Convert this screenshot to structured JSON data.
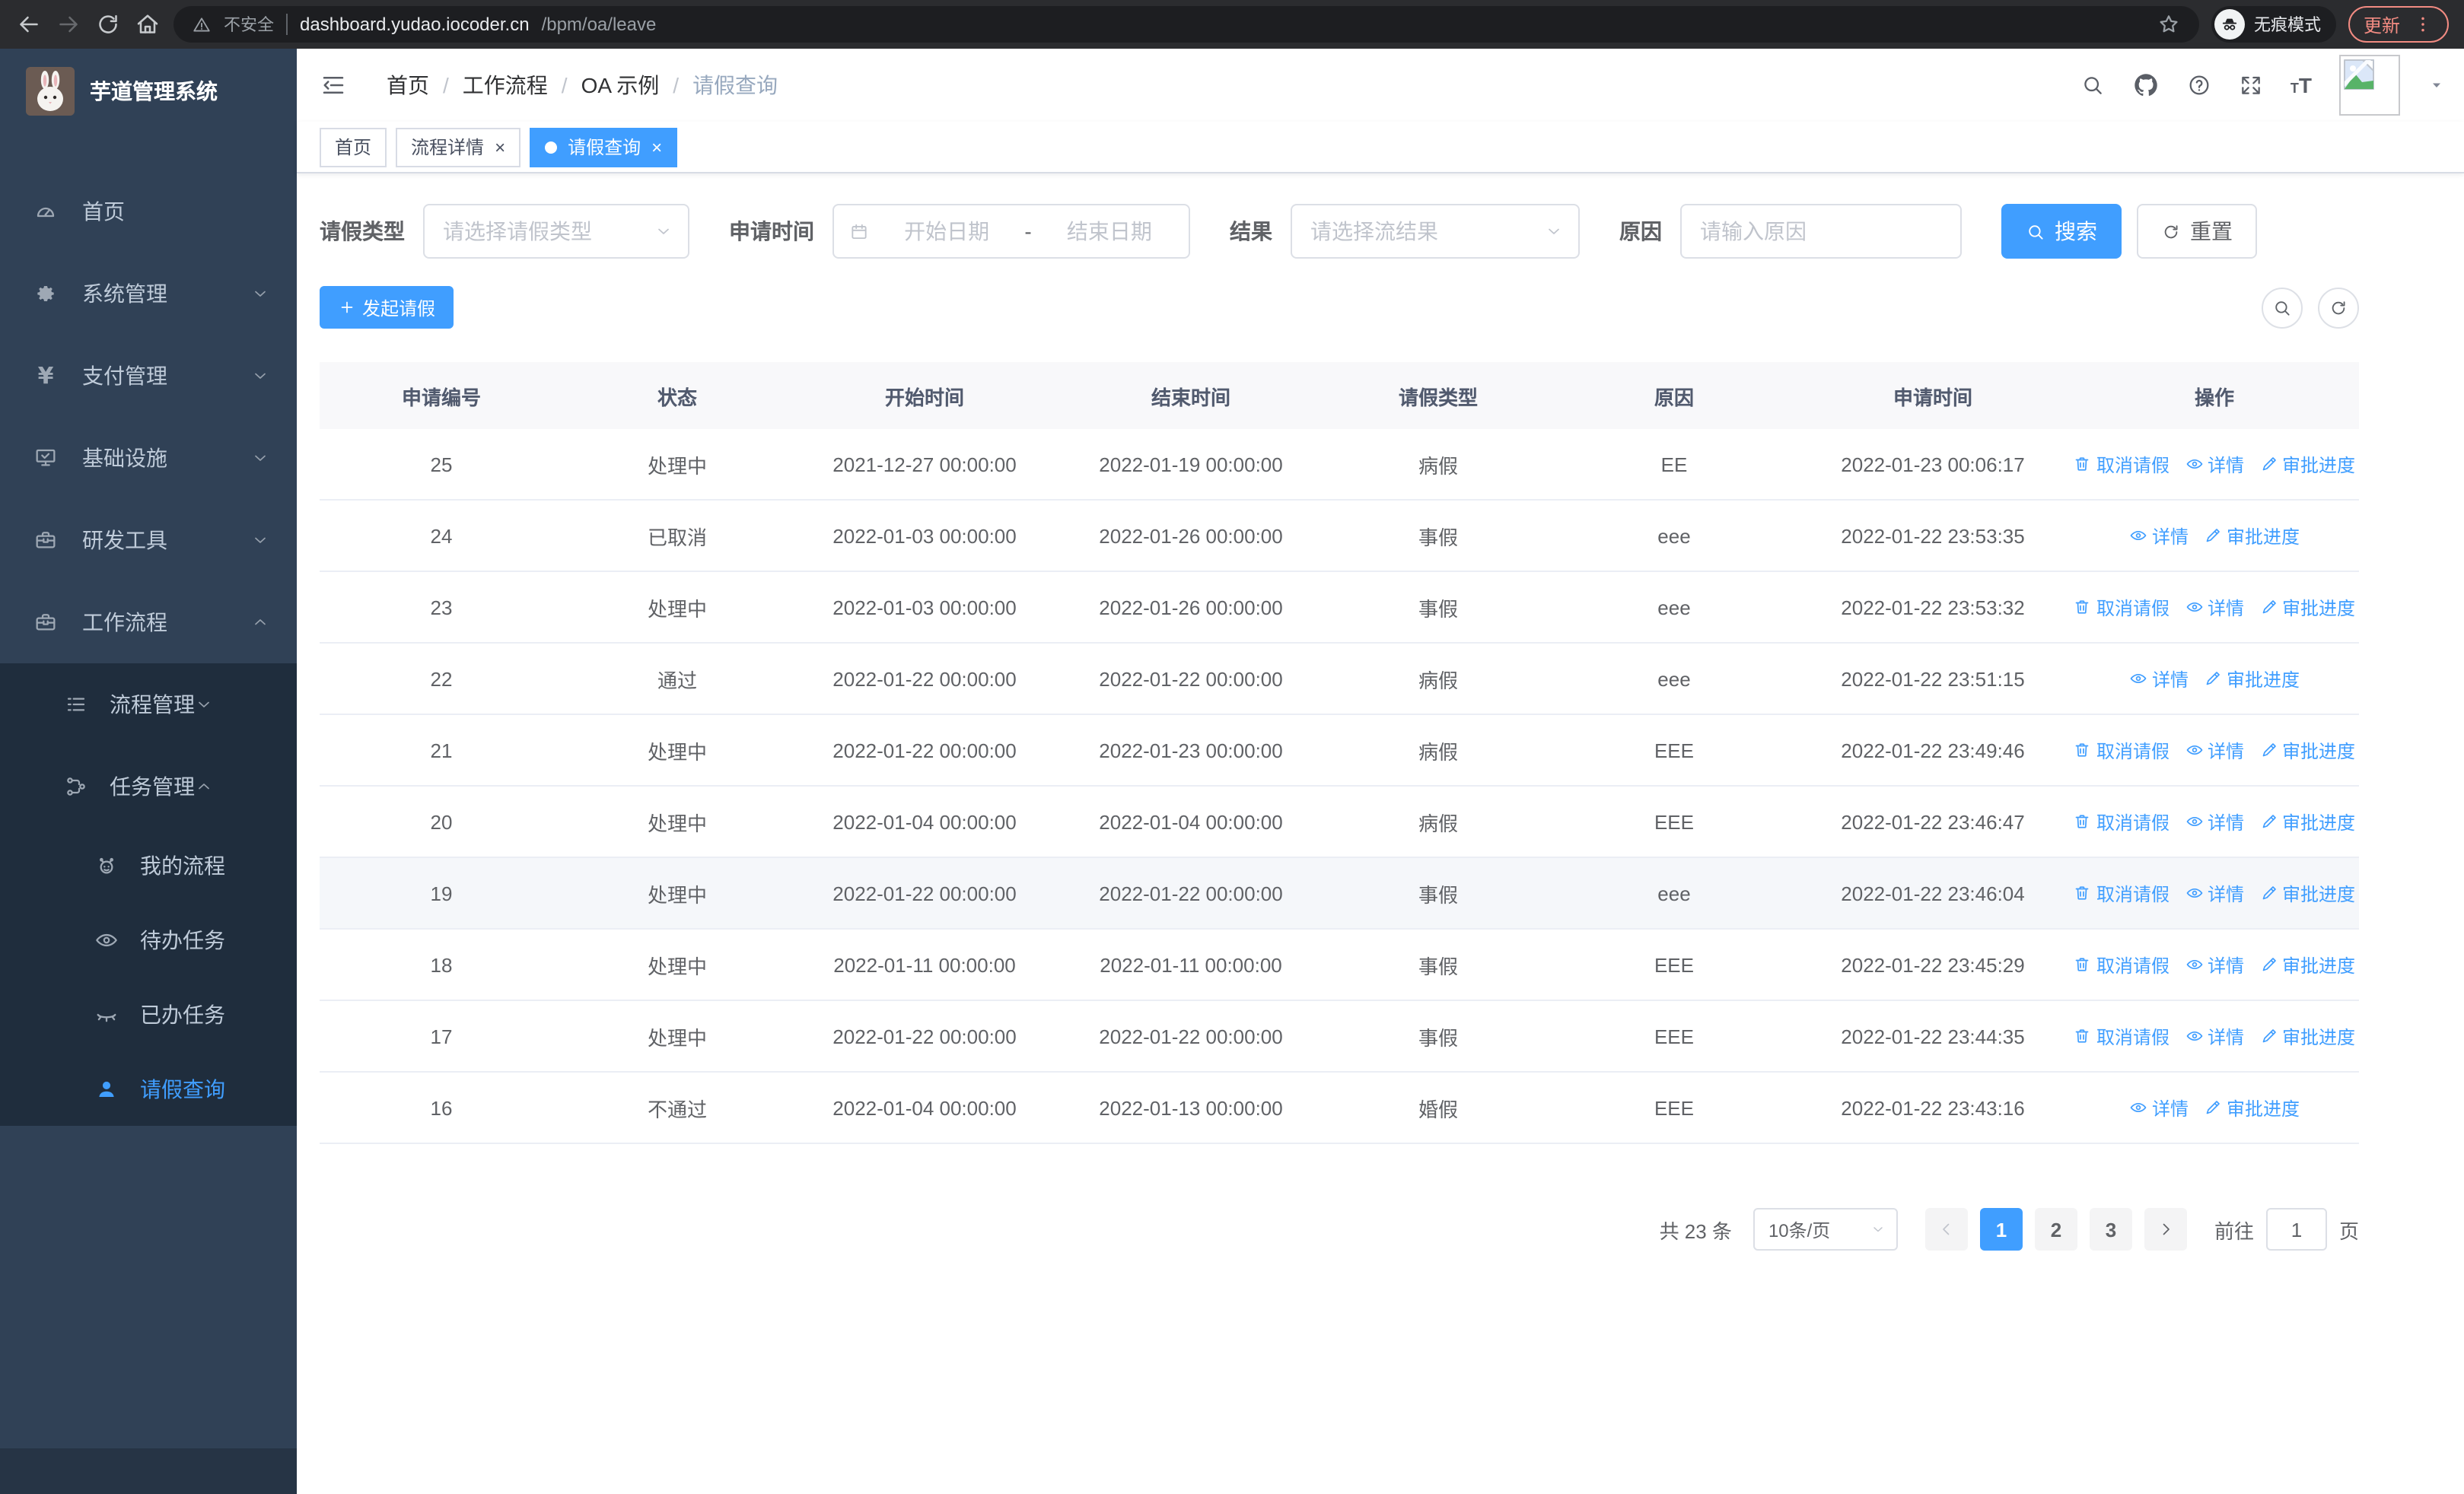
{
  "browser": {
    "security_label": "不安全",
    "url_host": "dashboard.yudao.iocoder.cn",
    "url_path": "/bpm/oa/leave",
    "incognito_label": "无痕模式",
    "update_label": "更新",
    "icons": [
      "back-icon",
      "forward-icon",
      "reload-icon",
      "home-icon",
      "warning-icon",
      "star-icon",
      "incognito-icon",
      "kebab-menu-icon"
    ]
  },
  "sidebar": {
    "logo_title": "芋道管理系统",
    "items": [
      {
        "label": "首页",
        "icon": "dashboard-icon"
      },
      {
        "label": "系统管理",
        "icon": "gear-icon",
        "state": "collapsed"
      },
      {
        "label": "支付管理",
        "icon": "yen-icon",
        "state": "collapsed"
      },
      {
        "label": "基础设施",
        "icon": "monitor-icon",
        "state": "collapsed"
      },
      {
        "label": "研发工具",
        "icon": "toolbox-icon",
        "state": "collapsed"
      },
      {
        "label": "工作流程",
        "icon": "briefcase-icon",
        "state": "expanded"
      }
    ],
    "submenu": [
      {
        "label": "流程管理",
        "icon": "list-icon",
        "state": "collapsed"
      },
      {
        "label": "任务管理",
        "icon": "flow-icon",
        "state": "expanded",
        "children": [
          {
            "label": "我的流程",
            "icon": "robot-icon"
          },
          {
            "label": "待办任务",
            "icon": "eye-icon"
          },
          {
            "label": "已办任务",
            "icon": "eye-closed-icon"
          },
          {
            "label": "请假查询",
            "icon": "user-icon",
            "active": true
          }
        ]
      }
    ]
  },
  "header": {
    "breadcrumb": [
      "首页",
      "工作流程",
      "OA 示例",
      "请假查询"
    ],
    "separator": "/",
    "right_icons": [
      "search-icon",
      "github-icon",
      "help-icon",
      "fullscreen-icon",
      "font-size-icon",
      "avatar-broken-image",
      "caret-down-icon"
    ]
  },
  "tags": [
    {
      "label": "首页",
      "active": false,
      "closable": false
    },
    {
      "label": "流程详情",
      "active": false,
      "closable": true
    },
    {
      "label": "请假查询",
      "active": true,
      "closable": true
    }
  ],
  "filters": {
    "leave_type_label": "请假类型",
    "leave_type_placeholder": "请选择请假类型",
    "apply_time_label": "申请时间",
    "start_date_placeholder": "开始日期",
    "range_separator": "-",
    "end_date_placeholder": "结束日期",
    "result_label": "结果",
    "result_placeholder": "请选择流结果",
    "reason_label": "原因",
    "reason_placeholder": "请输入原因",
    "search_button": "搜索",
    "reset_button": "重置"
  },
  "toolbar": {
    "create_button": "发起请假"
  },
  "table": {
    "columns": [
      "申请编号",
      "状态",
      "开始时间",
      "结束时间",
      "请假类型",
      "原因",
      "申请时间",
      "操作"
    ],
    "action_labels": {
      "cancel": "取消请假",
      "detail": "详情",
      "progress": "审批进度"
    },
    "rows": [
      {
        "id": "25",
        "status": "处理中",
        "start": "2021-12-27 00:00:00",
        "end": "2022-01-19 00:00:00",
        "type": "病假",
        "reason": "EE",
        "apply": "2022-01-23 00:06:17",
        "actions": [
          "cancel",
          "detail",
          "progress"
        ]
      },
      {
        "id": "24",
        "status": "已取消",
        "start": "2022-01-03 00:00:00",
        "end": "2022-01-26 00:00:00",
        "type": "事假",
        "reason": "eee",
        "apply": "2022-01-22 23:53:35",
        "actions": [
          "detail",
          "progress"
        ]
      },
      {
        "id": "23",
        "status": "处理中",
        "start": "2022-01-03 00:00:00",
        "end": "2022-01-26 00:00:00",
        "type": "事假",
        "reason": "eee",
        "apply": "2022-01-22 23:53:32",
        "actions": [
          "cancel",
          "detail",
          "progress"
        ]
      },
      {
        "id": "22",
        "status": "通过",
        "start": "2022-01-22 00:00:00",
        "end": "2022-01-22 00:00:00",
        "type": "病假",
        "reason": "eee",
        "apply": "2022-01-22 23:51:15",
        "actions": [
          "detail",
          "progress"
        ]
      },
      {
        "id": "21",
        "status": "处理中",
        "start": "2022-01-22 00:00:00",
        "end": "2022-01-23 00:00:00",
        "type": "病假",
        "reason": "EEE",
        "apply": "2022-01-22 23:49:46",
        "actions": [
          "cancel",
          "detail",
          "progress"
        ]
      },
      {
        "id": "20",
        "status": "处理中",
        "start": "2022-01-04 00:00:00",
        "end": "2022-01-04 00:00:00",
        "type": "病假",
        "reason": "EEE",
        "apply": "2022-01-22 23:46:47",
        "actions": [
          "cancel",
          "detail",
          "progress"
        ]
      },
      {
        "id": "19",
        "status": "处理中",
        "start": "2022-01-22 00:00:00",
        "end": "2022-01-22 00:00:00",
        "type": "事假",
        "reason": "eee",
        "apply": "2022-01-22 23:46:04",
        "actions": [
          "cancel",
          "detail",
          "progress"
        ],
        "highlighted": true
      },
      {
        "id": "18",
        "status": "处理中",
        "start": "2022-01-11 00:00:00",
        "end": "2022-01-11 00:00:00",
        "type": "事假",
        "reason": "EEE",
        "apply": "2022-01-22 23:45:29",
        "actions": [
          "cancel",
          "detail",
          "progress"
        ]
      },
      {
        "id": "17",
        "status": "处理中",
        "start": "2022-01-22 00:00:00",
        "end": "2022-01-22 00:00:00",
        "type": "事假",
        "reason": "EEE",
        "apply": "2022-01-22 23:44:35",
        "actions": [
          "cancel",
          "detail",
          "progress"
        ]
      },
      {
        "id": "16",
        "status": "不通过",
        "start": "2022-01-04 00:00:00",
        "end": "2022-01-13 00:00:00",
        "type": "婚假",
        "reason": "EEE",
        "apply": "2022-01-22 23:43:16",
        "actions": [
          "detail",
          "progress"
        ]
      }
    ]
  },
  "pagination": {
    "total_label": "共 23 条",
    "page_size": "10条/页",
    "pages": [
      "1",
      "2",
      "3"
    ],
    "active_page": "1",
    "goto_label": "前往",
    "goto_value": "1",
    "goto_suffix": "页"
  },
  "colors": {
    "accent": "#409eff",
    "sidebar_bg": "#304156",
    "submenu_bg": "#1f2d3d",
    "sidebar_text": "#bfcbd9",
    "update_badge": "#f28b82",
    "table_header_bg": "#f8f8fa",
    "table_border": "#ebeef5",
    "row_hover_bg": "#f5f7fa"
  }
}
